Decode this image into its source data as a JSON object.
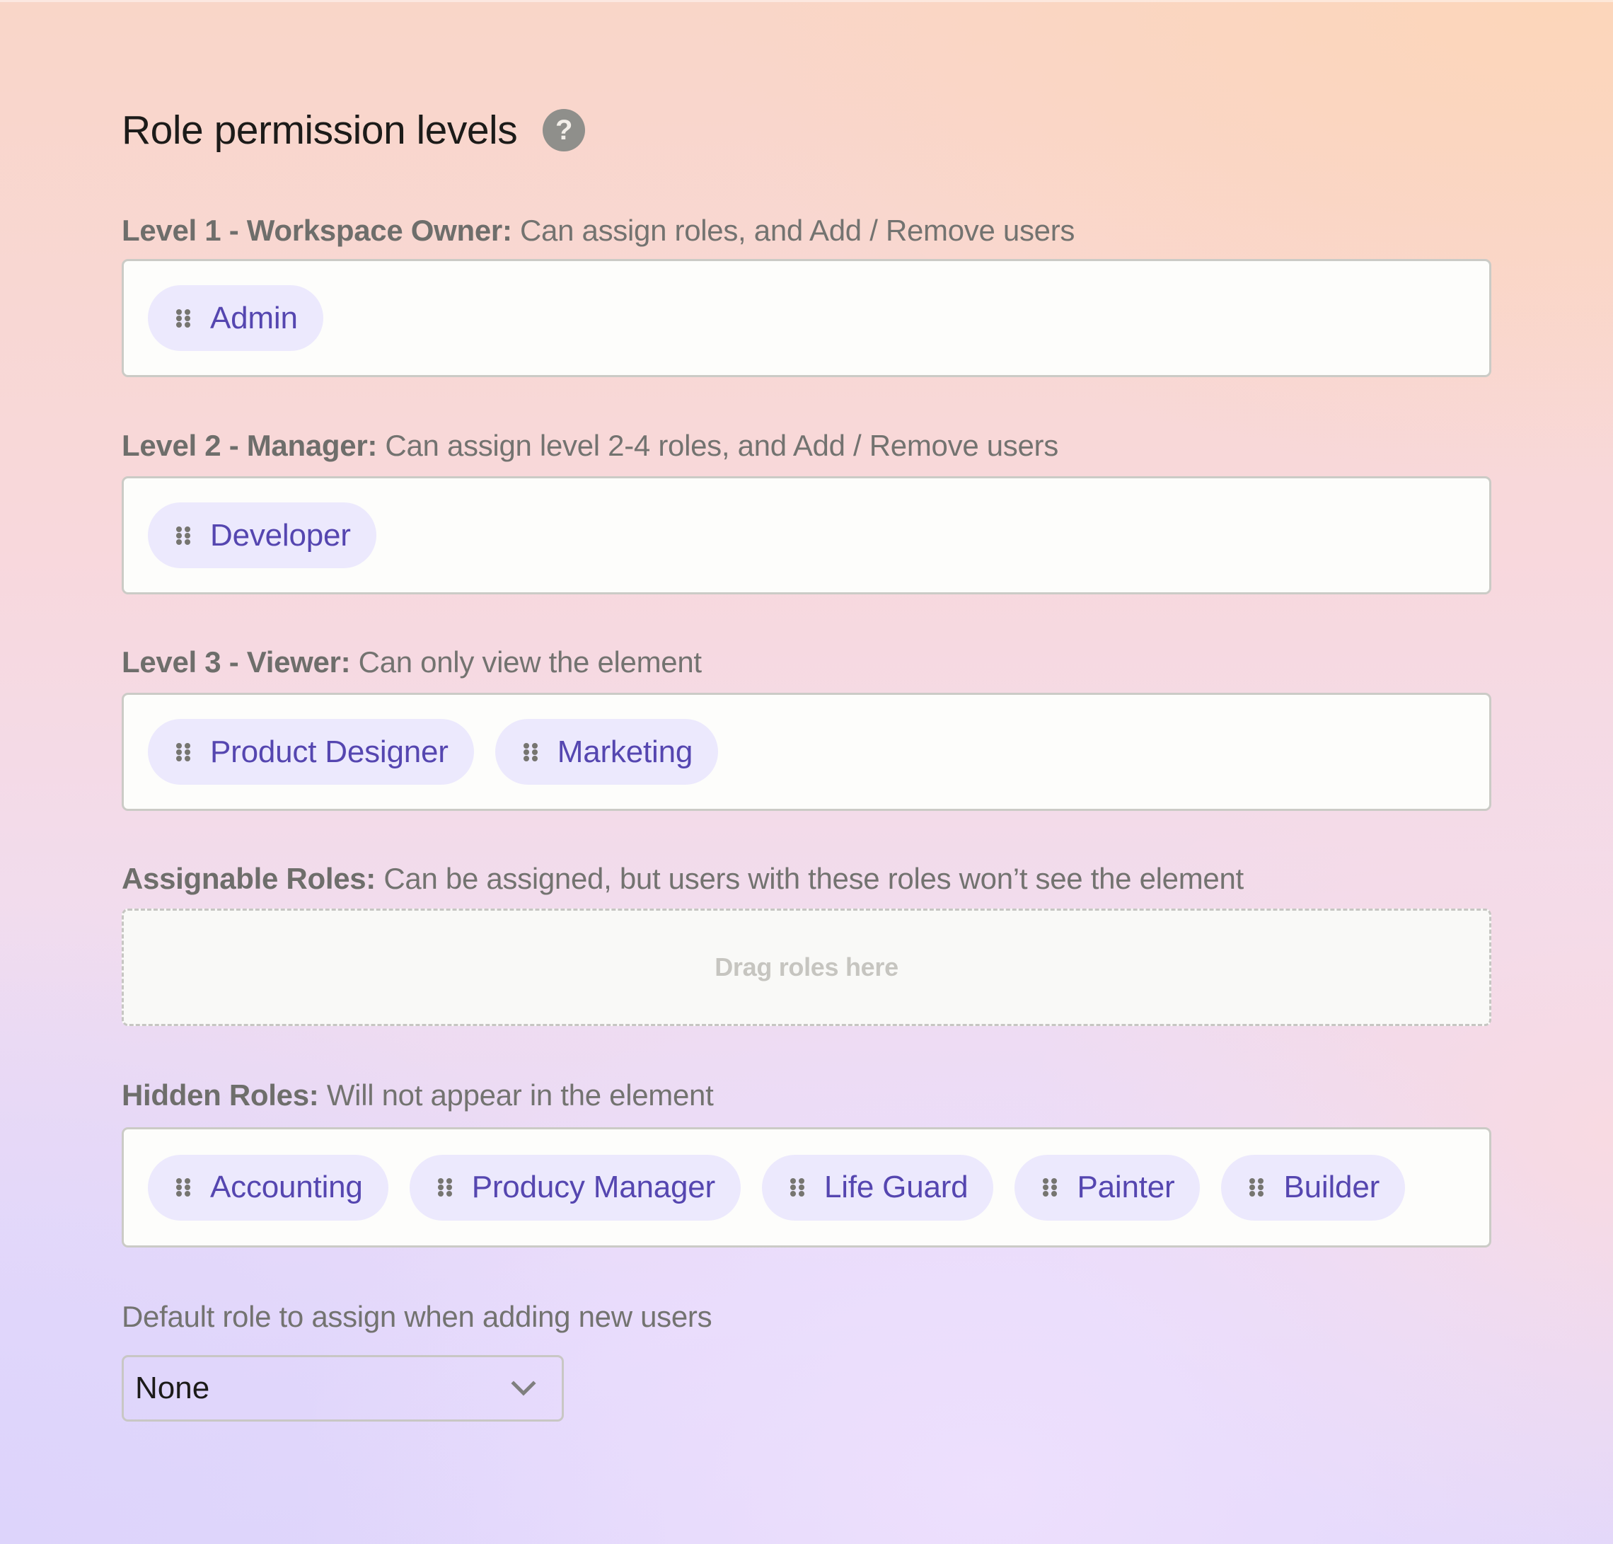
{
  "header": {
    "title": "Role permission levels",
    "help_icon": "question-circle-icon"
  },
  "sections": [
    {
      "id": "level-1",
      "label_bold": "Level 1 - Workspace Owner:",
      "label_desc": " Can assign roles, and Add / Remove users",
      "roles": [
        "Admin"
      ]
    },
    {
      "id": "level-2",
      "label_bold": "Level 2 - Manager:",
      "label_desc": " Can assign level 2-4 roles, and Add / Remove users",
      "roles": [
        "Developer"
      ]
    },
    {
      "id": "level-3",
      "label_bold": "Level 3 - Viewer:",
      "label_desc": " Can only view the element",
      "roles": [
        "Product Designer",
        "Marketing"
      ]
    },
    {
      "id": "assignable",
      "label_bold": "Assignable Roles:",
      "label_desc": " Can be assigned, but users with these roles won’t see the element",
      "roles": [],
      "empty_hint": "Drag roles here"
    },
    {
      "id": "hidden",
      "label_bold": "Hidden Roles:",
      "label_desc": " Will not appear in the element",
      "roles": [
        "Accounting",
        "Producy Manager",
        "Life Guard",
        "Painter",
        "Builder"
      ]
    }
  ],
  "default_role": {
    "label": "Default role to assign when adding new users",
    "selected": "None",
    "icon": "chevron-down-icon"
  },
  "colors": {
    "chip_bg": "#ece9fd",
    "chip_text": "#5546b0",
    "handle": "#767570",
    "label_text": "#737370",
    "title_text": "#1c1b19"
  }
}
